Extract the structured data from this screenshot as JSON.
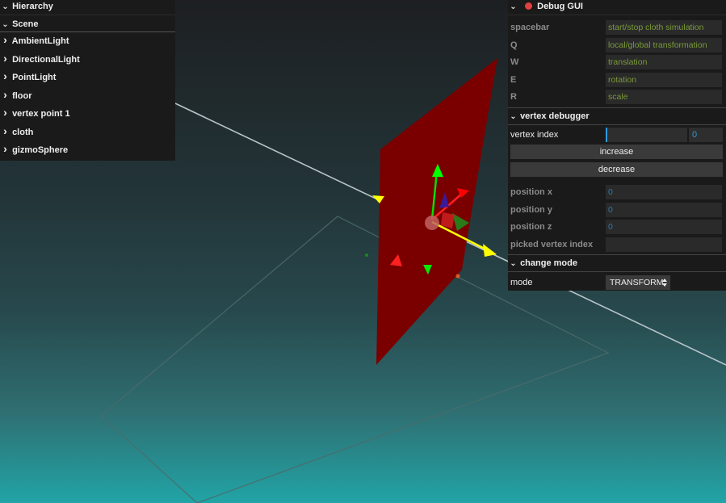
{
  "hierarchy": {
    "title": "Hierarchy",
    "scene_title": "Scene",
    "items": [
      {
        "label": "AmbientLight"
      },
      {
        "label": "DirectionalLight"
      },
      {
        "label": "PointLight"
      },
      {
        "label": "floor"
      },
      {
        "label": "vertex point 1"
      },
      {
        "label": "cloth"
      },
      {
        "label": "gizmoSphere"
      }
    ]
  },
  "gui": {
    "title": "Debug GUI",
    "keys": [
      {
        "key": "spacebar",
        "action": "start/stop cloth simulation"
      },
      {
        "key": "Q",
        "action": "local/global transformation"
      },
      {
        "key": "W",
        "action": "translation"
      },
      {
        "key": "E",
        "action": "rotation"
      },
      {
        "key": "R",
        "action": "scale"
      }
    ],
    "vertex_debugger": {
      "title": "vertex debugger",
      "vertex_index_label": "vertex index",
      "vertex_index_value": "0",
      "increase_label": "increase",
      "decrease_label": "decrease",
      "position_x_label": "position x",
      "position_x_value": "0",
      "position_y_label": "position y",
      "position_y_value": "0",
      "position_z_label": "position z",
      "position_z_value": "0",
      "picked_label": "picked vertex index",
      "picked_value": ""
    },
    "change_mode": {
      "title": "change mode",
      "mode_label": "mode",
      "mode_value": "TRANSFORM"
    }
  },
  "colors": {
    "cloth": "#7a0000",
    "axis_x": "#ffff00",
    "axis_y": "#00ff00",
    "axis_z": "#ff0000",
    "accent": "#2f9adf"
  }
}
